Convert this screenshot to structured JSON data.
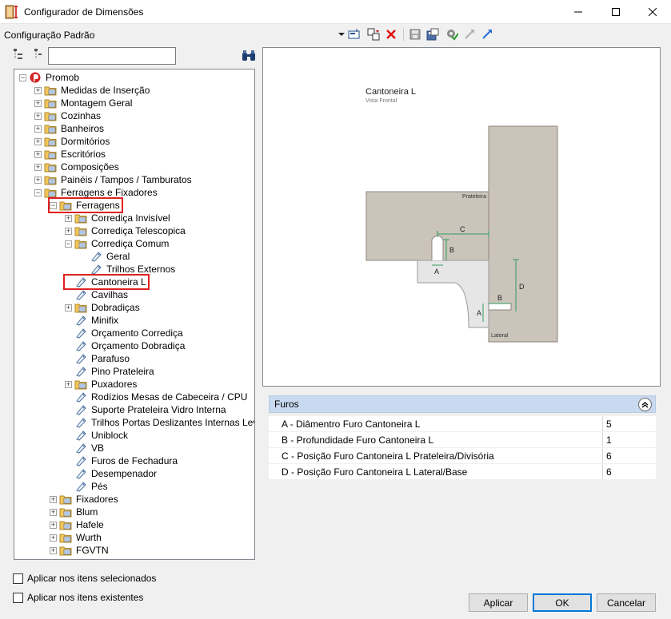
{
  "window": {
    "title": "Configurador de Dimensões"
  },
  "toolbar": {
    "config_label": "Configuração Padrão"
  },
  "tree": {
    "search_value": "",
    "nodes": [
      {
        "label": "Promob",
        "level": 0,
        "expander": "-",
        "icon": "promob-logo-icon"
      },
      {
        "label": "Medidas de Inserção",
        "level": 1,
        "expander": "+",
        "icon": "folder-icon"
      },
      {
        "label": "Montagem Geral",
        "level": 1,
        "expander": "+",
        "icon": "folder-icon"
      },
      {
        "label": "Cozinhas",
        "level": 1,
        "expander": "+",
        "icon": "folder-icon"
      },
      {
        "label": "Banheiros",
        "level": 1,
        "expander": "+",
        "icon": "folder-icon"
      },
      {
        "label": "Dormitórios",
        "level": 1,
        "expander": "+",
        "icon": "folder-icon"
      },
      {
        "label": "Escritórios",
        "level": 1,
        "expander": "+",
        "icon": "folder-icon"
      },
      {
        "label": "Composições",
        "level": 1,
        "expander": "+",
        "icon": "folder-icon"
      },
      {
        "label": "Painéis / Tampos / Tamburatos",
        "level": 1,
        "expander": "+",
        "icon": "folder-icon"
      },
      {
        "label": "Ferragens e Fixadores",
        "level": 1,
        "expander": "-",
        "icon": "folder-icon"
      },
      {
        "label": "Ferragens",
        "level": 2,
        "expander": "-",
        "icon": "folder-icon",
        "highlight": true
      },
      {
        "label": "Corrediça Invisível",
        "level": 3,
        "expander": "+",
        "icon": "folder-icon"
      },
      {
        "label": "Corrediça Telescopica",
        "level": 3,
        "expander": "+",
        "icon": "folder-icon"
      },
      {
        "label": "Corrediça Comum",
        "level": 3,
        "expander": "-",
        "icon": "folder-icon"
      },
      {
        "label": "Geral",
        "level": 4,
        "expander": "",
        "icon": "tag-icon"
      },
      {
        "label": "Trilhos Externos",
        "level": 4,
        "expander": "",
        "icon": "tag-icon"
      },
      {
        "label": "Cantoneira L",
        "level": 3,
        "expander": "",
        "icon": "tag-icon",
        "highlight": true
      },
      {
        "label": "Cavilhas",
        "level": 3,
        "expander": "",
        "icon": "tag-icon"
      },
      {
        "label": "Dobradiças",
        "level": 3,
        "expander": "+",
        "icon": "folder-icon"
      },
      {
        "label": "Minifix",
        "level": 3,
        "expander": "",
        "icon": "tag-icon"
      },
      {
        "label": "Orçamento Corrediça",
        "level": 3,
        "expander": "",
        "icon": "tag-icon"
      },
      {
        "label": "Orçamento Dobradiça",
        "level": 3,
        "expander": "",
        "icon": "tag-icon"
      },
      {
        "label": "Parafuso",
        "level": 3,
        "expander": "",
        "icon": "tag-icon"
      },
      {
        "label": "Pino Prateleira",
        "level": 3,
        "expander": "",
        "icon": "tag-icon"
      },
      {
        "label": "Puxadores",
        "level": 3,
        "expander": "+",
        "icon": "folder-icon"
      },
      {
        "label": "Rodízios Mesas de Cabeceira / CPU",
        "level": 3,
        "expander": "",
        "icon": "tag-icon"
      },
      {
        "label": "Suporte Prateleira Vidro Interna",
        "level": 3,
        "expander": "",
        "icon": "tag-icon"
      },
      {
        "label": "Trilhos Portas Deslizantes Internas Leves",
        "level": 3,
        "expander": "",
        "icon": "tag-icon"
      },
      {
        "label": "Uniblock",
        "level": 3,
        "expander": "",
        "icon": "tag-icon"
      },
      {
        "label": "VB",
        "level": 3,
        "expander": "",
        "icon": "tag-icon"
      },
      {
        "label": "Furos de Fechadura",
        "level": 3,
        "expander": "",
        "icon": "tag-icon"
      },
      {
        "label": "Desempenador",
        "level": 3,
        "expander": "",
        "icon": "tag-icon"
      },
      {
        "label": "Pés",
        "level": 3,
        "expander": "",
        "icon": "tag-icon"
      },
      {
        "label": "Fixadores",
        "level": 2,
        "expander": "+",
        "icon": "folder-icon"
      },
      {
        "label": "Blum",
        "level": 2,
        "expander": "+",
        "icon": "folder-icon"
      },
      {
        "label": "Hafele",
        "level": 2,
        "expander": "+",
        "icon": "folder-icon"
      },
      {
        "label": "Wurth",
        "level": 2,
        "expander": "+",
        "icon": "folder-icon"
      },
      {
        "label": "FGVTN",
        "level": 2,
        "expander": "+",
        "icon": "folder-icon"
      }
    ]
  },
  "preview": {
    "title": "Cantoneira L",
    "subtitle": "Vista Frontal",
    "label_prateleira": "Prateleira",
    "label_lateral": "Lateral",
    "dim_a": "A",
    "dim_b": "B",
    "dim_c": "C",
    "dim_d": "D"
  },
  "properties": {
    "header": "Furos",
    "rows": [
      {
        "label": "A - Diâmentro Furo Cantoneira L",
        "value": "5"
      },
      {
        "label": "B - Profundidade Furo Cantoneira L",
        "value": "1"
      },
      {
        "label": "C - Posição Furo Cantoneira L Prateleira/Divisória",
        "value": "6"
      },
      {
        "label": "D - Posição Furo Cantoneira L Lateral/Base",
        "value": "6"
      }
    ]
  },
  "options": {
    "apply_selected": "Aplicar nos itens selecionados",
    "apply_existing": "Aplicar nos itens existentes"
  },
  "buttons": {
    "apply": "Aplicar",
    "ok": "OK",
    "cancel": "Cancelar"
  },
  "colors": {
    "panel": "#cbc4bb",
    "dimension": "#2e9e5e",
    "highlight": "#e02020",
    "group_header": "#c9d9ef"
  }
}
